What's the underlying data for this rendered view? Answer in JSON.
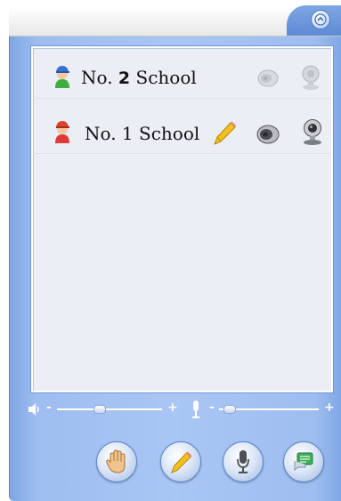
{
  "list": {
    "rows": [
      {
        "prefix": "No.",
        "number": "2",
        "suffix": "School",
        "avatar": "boy-blue-cap-avatar-icon",
        "active": false
      },
      {
        "prefix": "No.",
        "number": "1",
        "suffix": "School",
        "avatar": "boy-red-cap-avatar-icon",
        "active": true
      }
    ]
  },
  "controls": {
    "speaker_minus": "-",
    "speaker_plus": "+",
    "mic_minus": "-",
    "mic_plus": "+",
    "speaker_level": 0.4,
    "mic_level": 0.1
  },
  "icons": {
    "collapse": "chevron-up-circle-icon",
    "pencil": "pencil-icon",
    "speaker": "speaker-icon",
    "webcam": "webcam-icon",
    "raise_hand": "raise-hand-icon",
    "microphone": "microphone-icon",
    "chat": "chat-icon"
  },
  "colors": {
    "panel_blue": "#9ebdf0",
    "list_bg": "#eceef5",
    "pencil_yellow": "#f2c01e"
  }
}
